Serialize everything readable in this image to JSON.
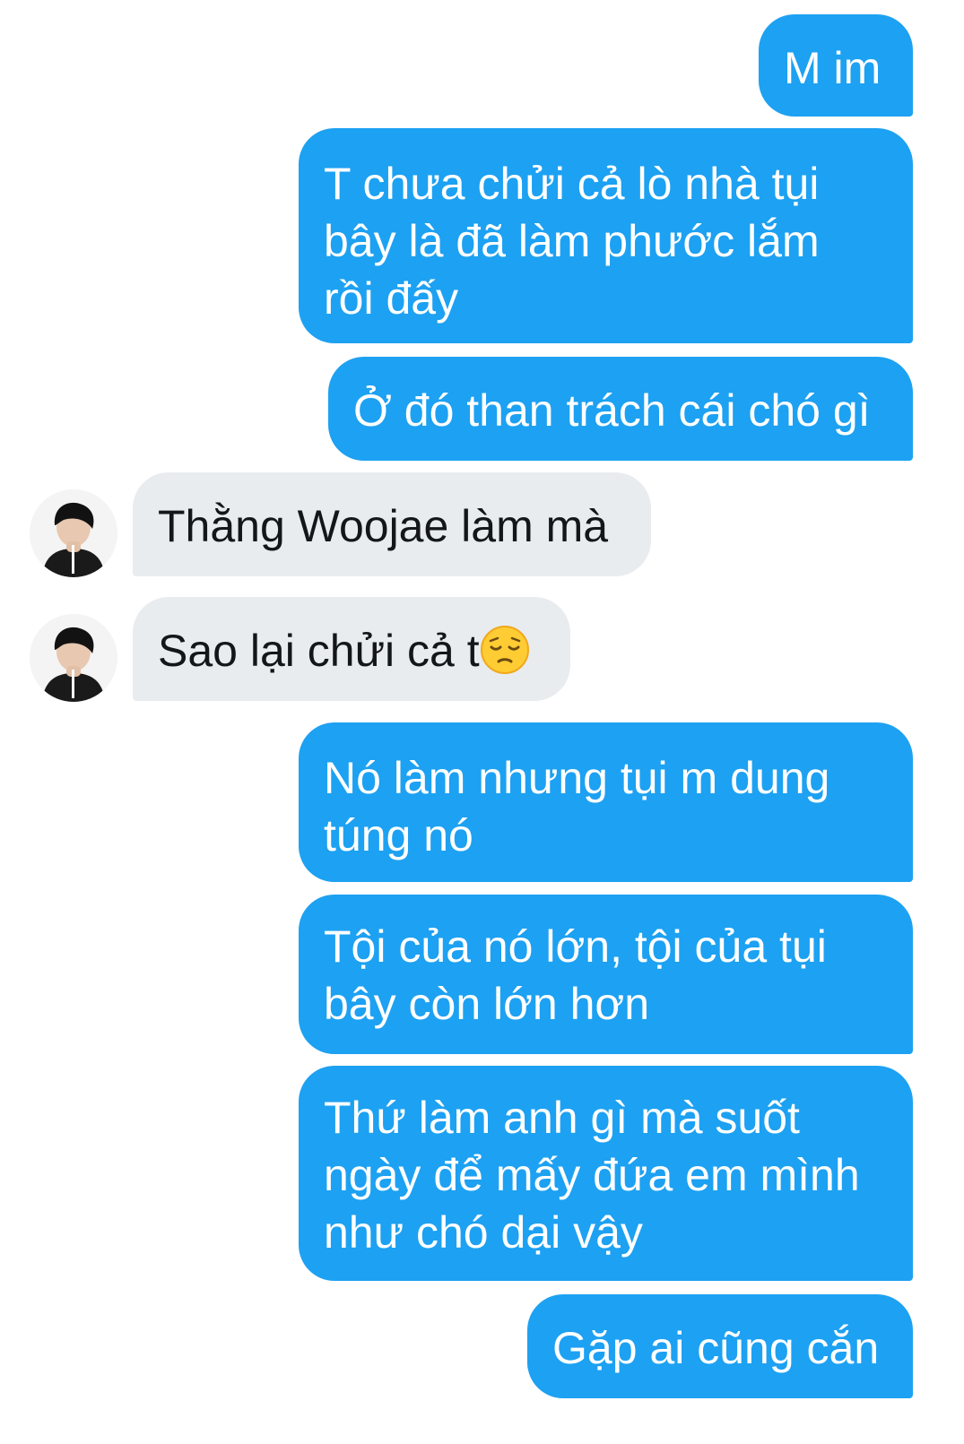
{
  "colors": {
    "sent_bubble": "#1da1f2",
    "received_bubble": "#e9ecef",
    "sent_text": "#ffffff",
    "received_text": "#14171a"
  },
  "messages": [
    {
      "side": "sent",
      "text": "M im"
    },
    {
      "side": "sent",
      "text": "T chưa chửi cả lò nhà tụi bây là đã làm phước lắm rồi đấy"
    },
    {
      "side": "sent",
      "text": "Ở đó than trách cái chó gì"
    },
    {
      "side": "received",
      "text": "Thằng Woojae làm mà",
      "avatar": "user-avatar"
    },
    {
      "side": "received",
      "text": "Sao lại chửi cả t",
      "emoji": "pensive-face-icon",
      "avatar": "user-avatar"
    },
    {
      "side": "sent",
      "text": "Nó làm nhưng tụi m dung túng nó"
    },
    {
      "side": "sent",
      "text": "Tội của nó lớn, tội của tụi bây còn lớn hơn"
    },
    {
      "side": "sent",
      "text": "Thứ làm anh gì mà suốt ngày để mấy đứa em mình như chó dại vậy"
    },
    {
      "side": "sent",
      "text": "Gặp ai cũng cắn"
    }
  ]
}
